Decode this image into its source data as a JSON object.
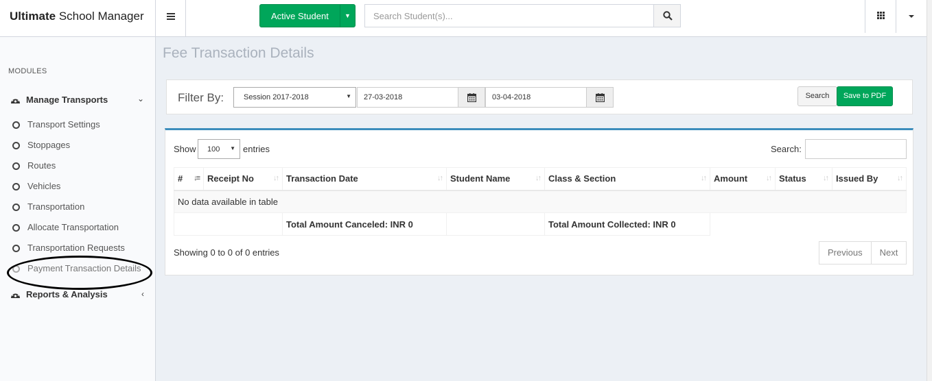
{
  "app": {
    "brand_bold": "Ultimate",
    "brand_rest": "School Manager"
  },
  "topbar": {
    "active_student_label": "Active Student",
    "search_placeholder": "Search Student(s)..."
  },
  "sidebar": {
    "modules_label": "MODULES",
    "manage_transports": "Manage Transports",
    "items": [
      "Transport Settings",
      "Stoppages",
      "Routes",
      "Vehicles",
      "Transportation",
      "Allocate Transportation",
      "Transportation Requests",
      "Payment Transaction Details"
    ],
    "reports": "Reports & Analysis"
  },
  "page": {
    "title": "Fee Transaction Details"
  },
  "filter": {
    "label": "Filter By:",
    "session": "Session 2017-2018",
    "date_from": "27-03-2018",
    "date_to": "03-04-2018",
    "search_label": "Search",
    "pdf_label": "Save to PDF"
  },
  "table": {
    "show_label": "Show",
    "page_size": "100",
    "entries_label": "entries",
    "search_label": "Search:",
    "columns": [
      "#",
      "Receipt No",
      "Transaction Date",
      "Student Name",
      "Class & Section",
      "Amount",
      "Status",
      "Issued By"
    ],
    "empty_text": "No data available in table",
    "total_canceled": "Total Amount Canceled: INR 0",
    "total_collected": "Total Amount Collected: INR 0",
    "info": "Showing 0 to 0 of 0 entries",
    "prev_label": "Previous",
    "next_label": "Next"
  },
  "colors": {
    "accent_green": "#00a65a",
    "accent_blue": "#3c8dbc"
  }
}
